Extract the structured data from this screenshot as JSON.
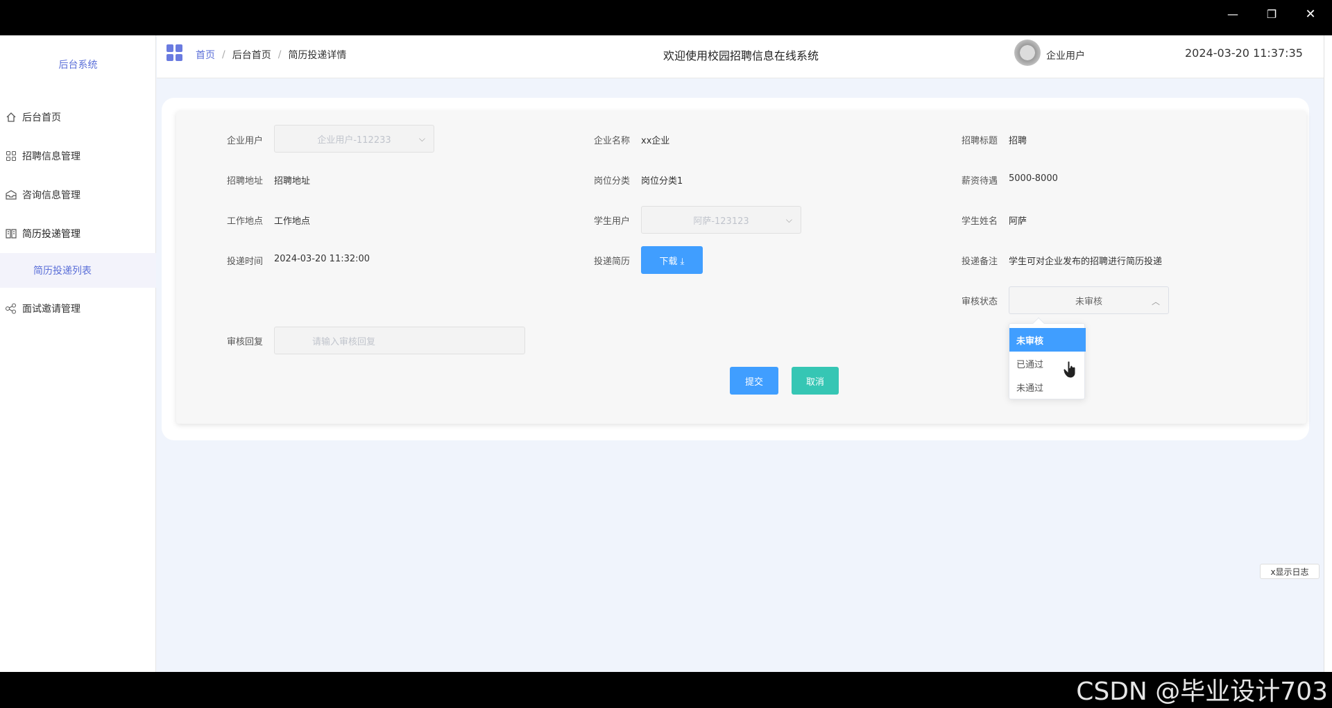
{
  "window": {
    "min": "—",
    "max": "❐",
    "close": "✕"
  },
  "sidebar": {
    "brand": "后台系统",
    "items": [
      {
        "label": "后台首页",
        "icon": "home-icon"
      },
      {
        "label": "招聘信息管理",
        "icon": "grid-icon"
      },
      {
        "label": "咨询信息管理",
        "icon": "inbox-icon"
      },
      {
        "label": "简历投递管理",
        "icon": "book-icon"
      },
      {
        "label": "面试邀请管理",
        "icon": "share-icon"
      }
    ],
    "sub_item": "简历投递列表"
  },
  "header": {
    "breadcrumb": [
      "首页",
      "后台首页",
      "简历投递详情"
    ],
    "title": "欢迎使用校园招聘信息在线系统",
    "user": "企业用户",
    "datetime": "2024-03-20 11:37:35"
  },
  "form": {
    "company_user_label": "企业用户",
    "company_user_value": "企业用户-112233",
    "company_name_label": "企业名称",
    "company_name_value": "xx企业",
    "job_title_label": "招聘标题",
    "job_title_value": "招聘",
    "job_address_label": "招聘地址",
    "job_address_value": "招聘地址",
    "category_label": "岗位分类",
    "category_value": "岗位分类1",
    "salary_label": "薪资待遇",
    "salary_value": "5000-8000",
    "work_location_label": "工作地点",
    "work_location_value": "工作地点",
    "student_user_label": "学生用户",
    "student_user_value": "阿萨-123123",
    "student_name_label": "学生姓名",
    "student_name_value": "阿萨",
    "submit_time_label": "投递时间",
    "submit_time_value": "2024-03-20 11:32:00",
    "resume_label": "投递简历",
    "download_label": "下载 ⤓",
    "remark_label": "投递备注",
    "remark_value": "学生可对企业发布的招聘进行简历投递",
    "status_label": "审核状态",
    "status_value": "未审核",
    "status_options": [
      "未审核",
      "已通过",
      "未通过"
    ],
    "reply_label": "审核回复",
    "reply_placeholder": "请输入审核回复",
    "submit_button": "提交",
    "cancel_button": "取消"
  },
  "log_button": "x显示日志",
  "watermark": "CSDN @毕业设计703"
}
